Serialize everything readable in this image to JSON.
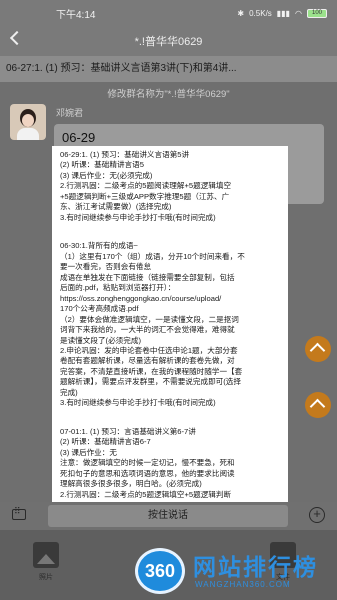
{
  "status": {
    "time": "下午4:14",
    "network": "0.5K/s",
    "battery": "100"
  },
  "header": {
    "title": "*.!普华华0629"
  },
  "pinned": {
    "text": "06-27:1. (1) 预习：基础讲义言语第3讲(下)和第4讲..."
  },
  "system_message": "修改群名称为\"*.!普华华0629\"",
  "message": {
    "sender": "邓婉君",
    "text": "06-29"
  },
  "document": {
    "lines": [
      "06-29:1. (1) 预习：基础讲义言语第5讲",
      "(2) 听课：基础精讲言语5",
      "(3) 课后作业：无(必须完成)",
      "2.行测巩固：二级考点的5题阅读理解+5题逻辑填空",
      "+5题逻辑判断+三级或APP数字推理5题（江苏、广",
      "东、浙江考试需要做）(选择完成)",
      "3.有时间继续参与申论手抄打卡哦(有时间完成)",
      "",
      "",
      "06-30:1.背所有的成语~",
      "（1）这里有170个（组）成语，分开10个时间来看，不",
      "要一次看完，否则会有倦怠",
      "成语在单独发在下面链接（链接需要全部复制，包括",
      "后面的.pdf，粘贴到浏览器打开）：",
      "https://oss.zonghenggongkao.cn/course/upload/",
      "170个公考高频成语.pdf",
      "（2）要体会做准逻辑填空，一是读懂文段，二是抠词",
      "词背下来我给的，一大半的词汇不会觉得难，难得就",
      "是读懂文段了(必须完成)",
      "2.申论巩固：发的申论套卷中任选申论1题，大部分套",
      "卷配有套题解析课，尽量选有解析课的套卷先做，对",
      "完答案，不清楚直接听课，在我的课程随时随学一【套",
      "题解析课】，需要点评发群里，不需要说完成即可(选择",
      "完成)",
      "3.有时间继续参与申论手抄打卡哦(有时间完成)",
      "",
      "",
      "07-01:1. (1) 预习：言语基础讲义第6-7讲",
      "(2) 听课：基础精讲言语6-7",
      "(3) 课后作业：无",
      "注意：做逻辑填空的时候一定切记，慢不要急，死和",
      "死扣句子的意思和选项词语的意思，他的要求比阅读",
      "理解高很多很多很多，明白哈。(必须完成)",
      "2.行测巩固：二级考点的5题逻辑填空+5题逻辑判断"
    ]
  },
  "input": {
    "hold_to_talk": "按住说话"
  },
  "tools": [
    {
      "label": "照片"
    },
    {
      "label": "文件"
    }
  ],
  "watermark": {
    "badge": "360",
    "name": "网站排行榜",
    "url": "WANGZHAN360.COM"
  }
}
